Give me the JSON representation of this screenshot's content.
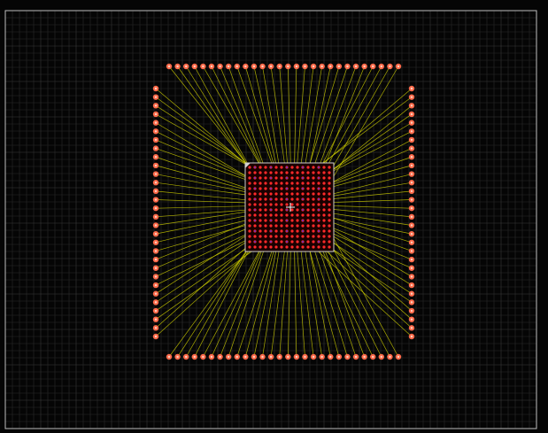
{
  "app": {
    "view": "package-bond-layout-canvas"
  },
  "colors": {
    "background": "#050505",
    "grid": "#2a2a2a",
    "grid_major": "#3a3a3a",
    "board_outline": "#bdbdbd",
    "lead_frame_pad": "#ff6a4a",
    "lead_frame_pad_core": "#ffd0c0",
    "bond_wire": "#c8c800",
    "die_outline": "#d0d0d0",
    "die_fill": "#1a0000",
    "die_pad": "#ff2a2a",
    "die_pad_center": "#3030ff",
    "crosshair": "#ffffff"
  },
  "package": {
    "top_pad_count": 28,
    "bottom_pad_count": 28,
    "left_pad_count": 30,
    "right_pad_count": 30,
    "die_pad_grid_cols": 16,
    "die_pad_grid_rows": 16
  },
  "icons": {
    "origin_marker": "crosshair-icon",
    "die_corner_marker": "die-corner-icon"
  }
}
